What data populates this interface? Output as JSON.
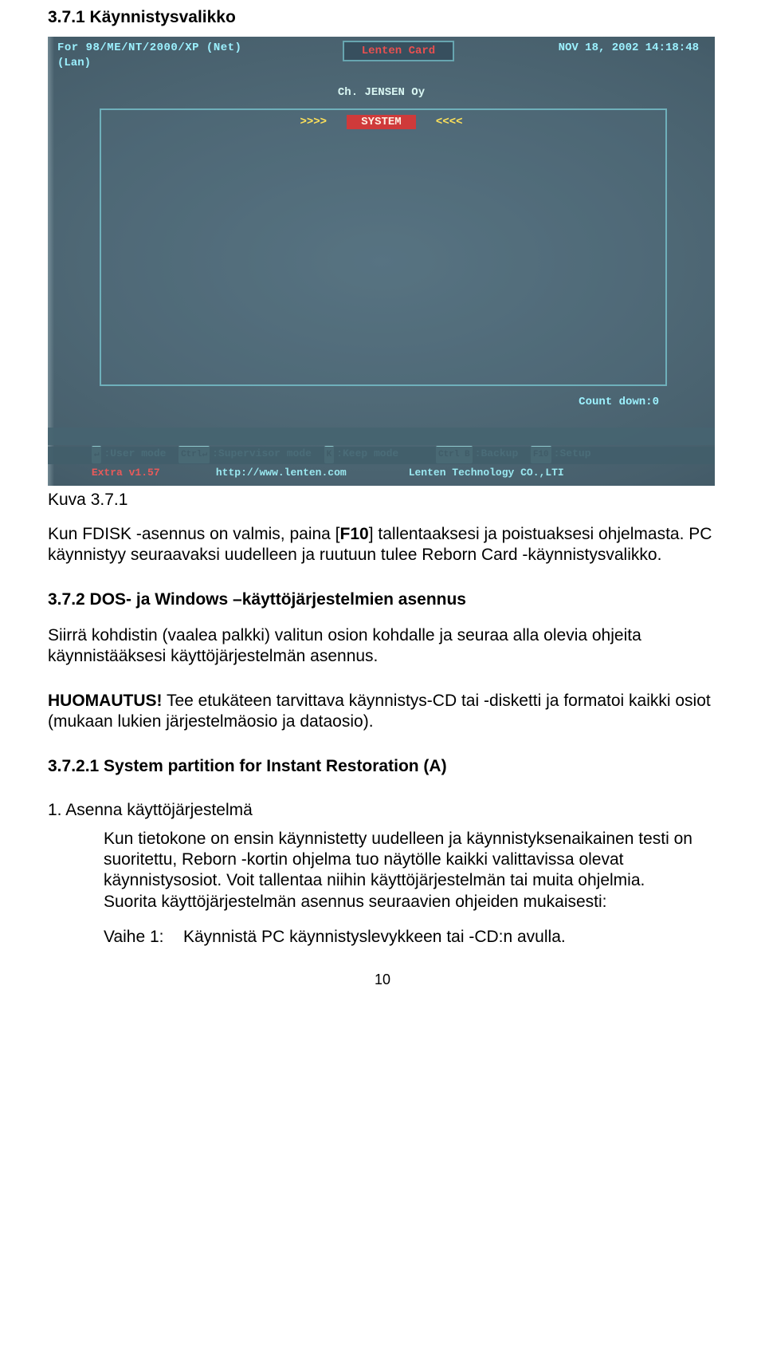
{
  "section371_title": "3.7.1 Käynnistysvalikko",
  "screenshot": {
    "line1": "For 98/ME/NT/2000/XP (Net)",
    "line2": "(Lan)",
    "datetime": "NOV 18, 2002 14:18:48",
    "title_box": "Lenten Card",
    "subtitle": "Ch. JENSEN Oy",
    "arrows_left": ">>>>",
    "system_label": "SYSTEM",
    "arrows_right": "<<<<",
    "countdown": "Count down:0",
    "footer1_user": "User mode",
    "footer1_super": "Supervisor mode",
    "footer1_keep": "Keep mode",
    "footer1_backup": "Backup",
    "footer1_setup": "Setup",
    "footer2_extra": "Extra v1.57",
    "footer2_url": "http://www.lenten.com",
    "footer2_co": "Lenten Technology CO.,LTI"
  },
  "caption": "Kuva 3.7.1",
  "para1_a": "Kun FDISK -asennus on valmis, paina [",
  "para1_key": "F10",
  "para1_b": "] tallentaaksesi ja poistuaksesi ohjelmasta. PC käynnistyy seuraavaksi uudelleen ja ruutuun tulee Reborn Card -käynnistysvalikko.",
  "section372_title": "3.7.2 DOS- ja Windows –käyttöjärjestelmien asennus",
  "para2": "Siirrä kohdistin (vaalea palkki) valitun osion kohdalle ja seuraa alla olevia ohjeita käynnistääksesi käyttöjärjestelmän asennus.",
  "note_label": "HUOMAUTUS!",
  "note_text": " Tee etukäteen tarvittava käynnistys-CD tai -disketti ja formatoi kaikki osiot (mukaan lukien järjestelmäosio ja dataosio).",
  "section3721_title": "3.7.2.1 System partition for Instant Restoration (A)",
  "list1_label": "1. Asenna käyttöjärjestelmä",
  "indent_para": "Kun tietokone on ensin käynnistetty uudelleen ja käynnistyksenaikainen testi on suoritettu, Reborn -kortin ohjelma tuo näytölle kaikki valittavissa olevat käynnistysosiot. Voit tallentaa niihin käyttöjärjestelmän tai muita ohjelmia. Suorita käyttöjärjestelmän asennus seuraavien ohjeiden mukaisesti:",
  "step1_label": "Vaihe 1:",
  "step1_text": "Käynnistä PC käynnistyslevykkeen tai -CD:n avulla.",
  "page_number": "10"
}
